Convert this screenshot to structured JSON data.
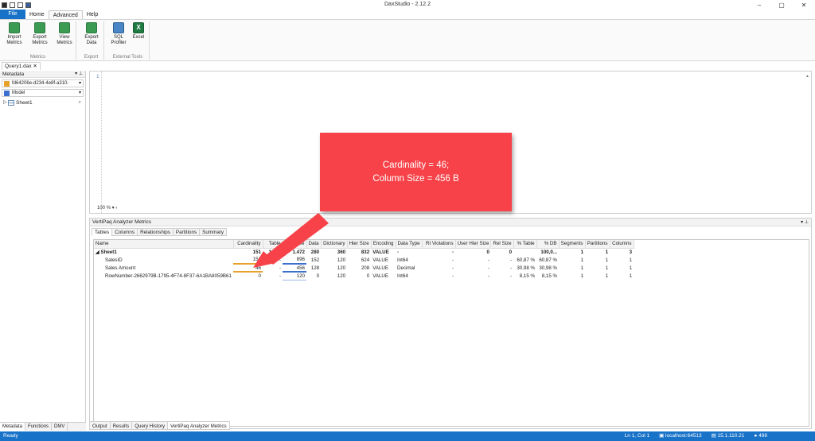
{
  "app": {
    "title": "DaxStudio - 2.12.2"
  },
  "ribbon": {
    "tabs": [
      "File",
      "Home",
      "Advanced",
      "Help"
    ],
    "active_tab": "Advanced",
    "groups": [
      {
        "name": "Metrics",
        "buttons": [
          {
            "label": "Import Metrics",
            "icon": "import-metrics-icon"
          },
          {
            "label": "Export Metrics",
            "icon": "export-metrics-icon"
          },
          {
            "label": "View Metrics",
            "icon": "view-metrics-icon"
          }
        ]
      },
      {
        "name": "Export",
        "buttons": [
          {
            "label": "Export Data",
            "icon": "export-data-icon"
          }
        ]
      },
      {
        "name": "External Tools",
        "buttons": [
          {
            "label": "SQL Profiler",
            "icon": "sql-profiler-icon"
          },
          {
            "label": "Excel",
            "icon": "excel-icon"
          }
        ]
      }
    ]
  },
  "document_tab": "Query1.dax",
  "metadata": {
    "header": "Metadata",
    "connection": "fd64206e-d234-4e8f-a310-",
    "model": "Model",
    "tree": [
      {
        "label": "Sheet1"
      }
    ],
    "bottom_tabs": [
      "Metadata",
      "Functions",
      "DMV"
    ]
  },
  "editor": {
    "line_number": "1",
    "zoom": "100 %"
  },
  "callout": {
    "line1": "Cardinality = 46;",
    "line2": "Column Size = 456 B"
  },
  "vertipaq": {
    "header": "VertiPaq Analyzer Metrics",
    "tabs": [
      "Tables",
      "Columns",
      "Relationships",
      "Partitions",
      "Summary"
    ],
    "columns": [
      "Name",
      "Cardinality",
      "Table",
      "Col Size",
      "Data",
      "Dictionary",
      "Hier Size",
      "Encoding",
      "Data Type",
      "RI Violations",
      "User Hier Size",
      "Rel Size",
      "% Table",
      "% DB",
      "Segments",
      "Partitions",
      "Columns"
    ],
    "rows": [
      {
        "name": "Sheet1",
        "cardinality": "151",
        "table": "1.472",
        "col_size": "1.472",
        "data": "280",
        "dictionary": "360",
        "hier_size": "832",
        "encoding": "VALUE",
        "data_type": "-",
        "ri_violations": "-",
        "user_hier_size": "0",
        "rel_size": "0",
        "pct_table": "",
        "pct_db": "100,0...",
        "segments": "1",
        "partitions": "1",
        "columns": "3"
      },
      {
        "name": "SalesID",
        "cardinality": "151",
        "table": "-",
        "col_size": "896",
        "data": "152",
        "dictionary": "120",
        "hier_size": "624",
        "encoding": "VALUE",
        "data_type": "Int64",
        "ri_violations": "-",
        "user_hier_size": "-",
        "rel_size": "-",
        "pct_table": "60,87 %",
        "pct_db": "60,87 %",
        "segments": "1",
        "partitions": "1",
        "columns": "1"
      },
      {
        "name": "Sales Amount",
        "cardinality": "46",
        "table": "-",
        "col_size": "456",
        "data": "128",
        "dictionary": "120",
        "hier_size": "208",
        "encoding": "VALUE",
        "data_type": "Decimal",
        "ri_violations": "-",
        "user_hier_size": "-",
        "rel_size": "-",
        "pct_table": "30,98 %",
        "pct_db": "30,98 %",
        "segments": "1",
        "partitions": "1",
        "columns": "1"
      },
      {
        "name": "RowNumber-2662979B-1795-4F74-8F37-6A1BA8059B61",
        "cardinality": "0",
        "table": "-",
        "col_size": "120",
        "data": "0",
        "dictionary": "120",
        "hier_size": "0",
        "encoding": "VALUE",
        "data_type": "Int64",
        "ri_violations": "-",
        "user_hier_size": "-",
        "rel_size": "-",
        "pct_table": "8,15 %",
        "pct_db": "8,15 %",
        "segments": "1",
        "partitions": "1",
        "columns": "1"
      }
    ]
  },
  "output_tabs": [
    "Output",
    "Results",
    "Query History",
    "VertiPaq Analyzer Metrics"
  ],
  "status": {
    "ready": "Ready",
    "position": "Ln 1, Col 1",
    "server": "localhost:64513",
    "version": "15.1.110.21",
    "user_count": "498"
  },
  "colors": {
    "accent": "#1872c8",
    "callout": "#f64248"
  }
}
